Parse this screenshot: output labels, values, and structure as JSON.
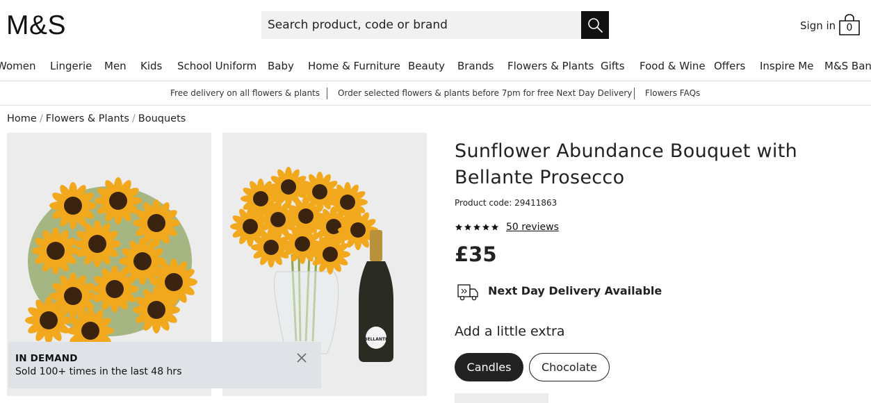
{
  "header": {
    "logo_text": "M&S",
    "search_placeholder": "Search product, code or brand",
    "sign_in_label": "Sign in",
    "basket_count": "0"
  },
  "nav": {
    "items": [
      "Women",
      "Lingerie",
      "Men",
      "Kids",
      "School Uniform",
      "Baby",
      "Home & Furniture",
      "Beauty",
      "Brands",
      "Flowers & Plants",
      "Gifts",
      "Food & Wine",
      "Offers",
      "Inspire Me",
      "M&S Bank"
    ]
  },
  "promo": {
    "items": [
      "Free delivery on all flowers & plants",
      "Order selected flowers & plants before 7pm for free Next Day Delivery",
      "Flowers FAQs"
    ]
  },
  "breadcrumb": {
    "items": [
      "Home",
      "Flowers & Plants",
      "Bouquets"
    ],
    "separator": "/"
  },
  "badge": {
    "title": "IN DEMAND",
    "text": "Sold 100+ times in the last 48 hrs"
  },
  "product": {
    "title": "Sunflower Abundance Bouquet with Bellante Prosecco",
    "code_text": "Product code: 29411863",
    "rating_stars": 5,
    "reviews_label": "50 reviews",
    "price": "£35",
    "delivery_text": "Next Day Delivery Available",
    "extras_heading": "Add a little extra",
    "extras": [
      {
        "label": "Candles",
        "selected": true
      },
      {
        "label": "Chocolate",
        "selected": false
      }
    ],
    "bottle_label": "BELLANTE"
  },
  "colors": {
    "accent": "#111111",
    "image_bg": "#ececec",
    "badge_bg": "#dfe3e7",
    "sunflower_petal": "#f2a81d",
    "sunflower_center": "#3a2410"
  }
}
